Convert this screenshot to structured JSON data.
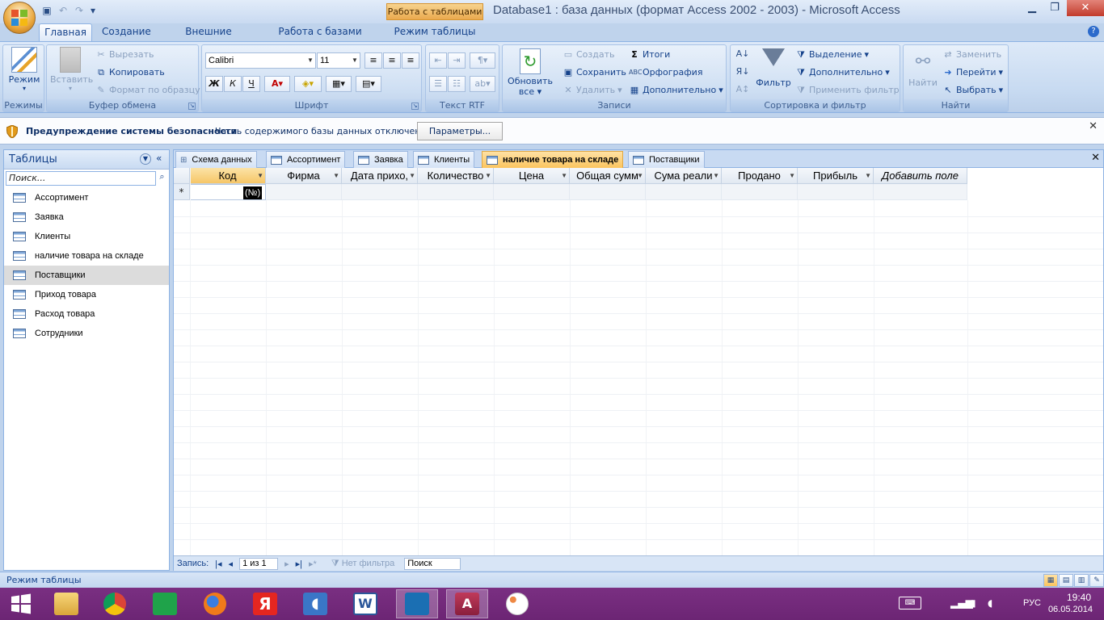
{
  "window": {
    "title": "Database1 : база данных (формат Access 2002 - 2003) - Microsoft Access",
    "context_tab": "Работа с таблицами"
  },
  "ribbon_tabs": [
    "Главная",
    "Создание",
    "Внешние данные",
    "Работа с базами данных",
    "Режим таблицы"
  ],
  "ribbon": {
    "modes": {
      "label": "Режимы",
      "mode_button": "Режим"
    },
    "clipboard": {
      "label": "Буфер обмена",
      "paste": "Вставить",
      "cut": "Вырезать",
      "copy": "Копировать",
      "format_painter": "Формат по образцу"
    },
    "font": {
      "label": "Шрифт",
      "font_name": "Calibri",
      "font_size": "11",
      "bold": "Ж",
      "italic": "К",
      "underline": "Ч"
    },
    "rtf": {
      "label": "Текст RTF"
    },
    "records": {
      "label": "Записи",
      "refresh": "Обновить",
      "refresh2": "все",
      "new": "Создать",
      "save": "Сохранить",
      "delete": "Удалить",
      "totals": "Итоги",
      "spelling": "Орфография",
      "more": "Дополнительно"
    },
    "sort_filter": {
      "label": "Сортировка и фильтр",
      "filter": "Фильтр",
      "selection": "Выделение",
      "advanced": "Дополнительно",
      "toggle_filter": "Применить фильтр"
    },
    "find": {
      "label": "Найти",
      "find": "Найти",
      "replace": "Заменить",
      "goto": "Перейти",
      "select": "Выбрать"
    }
  },
  "security_bar": {
    "title": "Предупреждение системы безопасности",
    "message": "Часть содержимого базы данных отключено",
    "options_button": "Параметры..."
  },
  "nav_pane": {
    "title": "Таблицы",
    "search_placeholder": "Поиск...",
    "items": [
      "Ассортимент",
      "Заявка",
      "Клиенты",
      "наличие товара на складе",
      "Поставщики",
      "Приход товара",
      "Расход товара",
      "Сотрудники"
    ],
    "selected_index": 4
  },
  "doc_tabs": [
    "Схема данных",
    "Ассортимент",
    "Заявка",
    "Клиенты",
    "наличие товара на складе",
    "Поставщики"
  ],
  "active_doc_tab": 4,
  "datasheet": {
    "columns": [
      "Код",
      "Фирма",
      "Дата прихо,",
      "Количество",
      "Цена",
      "Общая сумм",
      "Сума реали",
      "Продано",
      "Прибыль",
      "Добавить поле"
    ],
    "new_row_marker": "*",
    "autonumber_placeholder": "(№)"
  },
  "record_nav": {
    "label": "Запись:",
    "position": "1 из 1",
    "filter_status": "Нет фильтра",
    "search": "Поиск"
  },
  "status_bar": {
    "text": "Режим таблицы"
  },
  "taskbar": {
    "language": "РУС",
    "time": "19:40",
    "date": "06.05.2014"
  }
}
